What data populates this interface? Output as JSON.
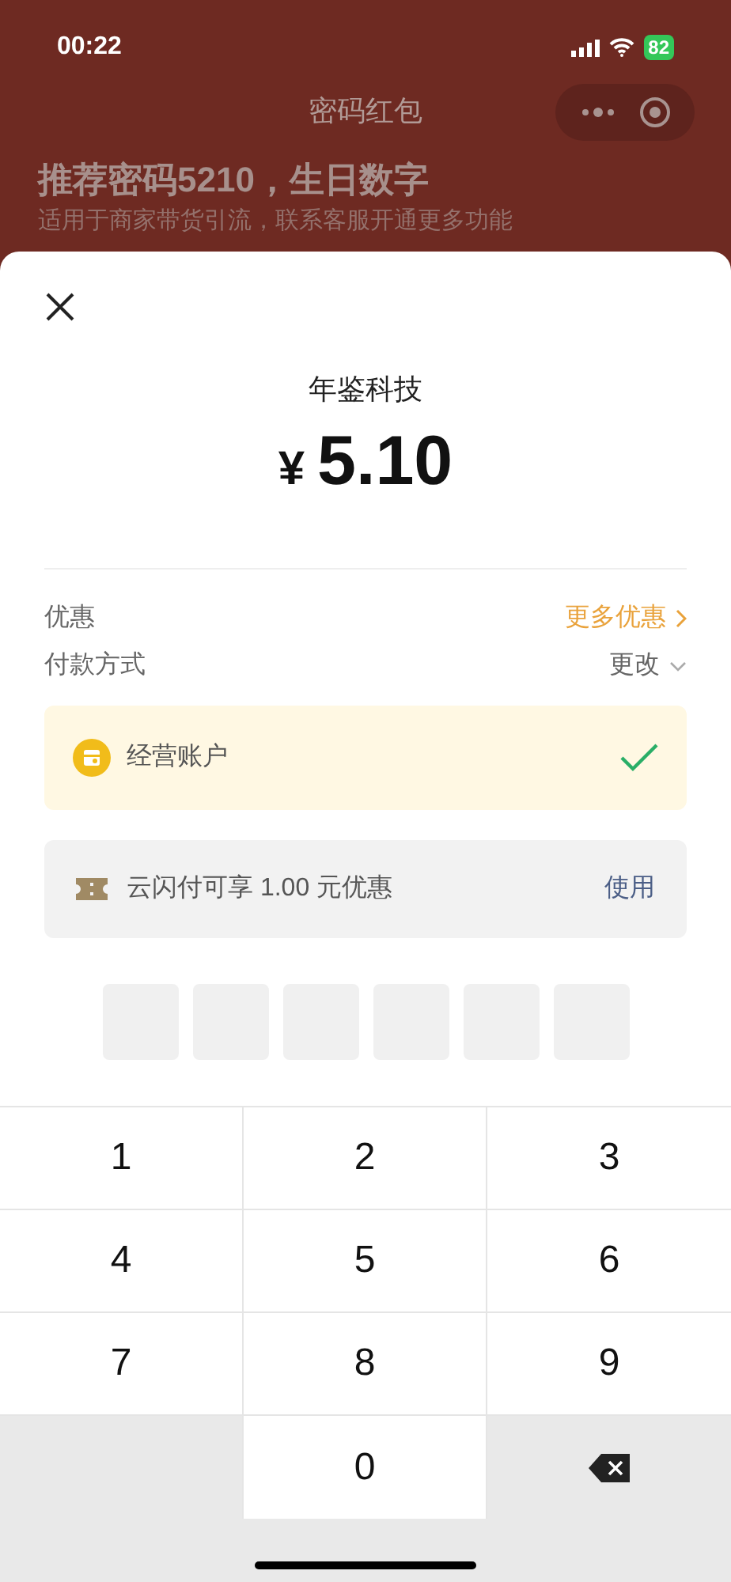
{
  "status_bar": {
    "time": "00:22",
    "battery": "82"
  },
  "header": {
    "title": "密码红包",
    "headline": "推荐密码5210，生日数字",
    "subtitle": "适用于商家带货引流，联系客服开通更多功能"
  },
  "payment": {
    "merchant": "年鉴科技",
    "currency": "¥",
    "amount": "5.10",
    "discount_row": {
      "label": "优惠",
      "action": "更多优惠"
    },
    "method_row": {
      "label": "付款方式",
      "action": "更改"
    },
    "accounts": [
      {
        "name": "经营账户",
        "selected": true
      }
    ],
    "coupon": {
      "text": "云闪付可享 1.00 元优惠",
      "action": "使用"
    },
    "pin": [
      {
        "filled": false
      },
      {
        "filled": false
      },
      {
        "filled": false
      },
      {
        "filled": false
      },
      {
        "filled": false
      },
      {
        "filled": false
      }
    ]
  },
  "keypad": [
    {
      "kind": "digit",
      "label": "1"
    },
    {
      "kind": "digit",
      "label": "2"
    },
    {
      "kind": "digit",
      "label": "3"
    },
    {
      "kind": "digit",
      "label": "4"
    },
    {
      "kind": "digit",
      "label": "5"
    },
    {
      "kind": "digit",
      "label": "6"
    },
    {
      "kind": "digit",
      "label": "7"
    },
    {
      "kind": "digit",
      "label": "8"
    },
    {
      "kind": "digit",
      "label": "9"
    },
    {
      "kind": "blank"
    },
    {
      "kind": "digit",
      "label": "0"
    },
    {
      "kind": "backspace"
    }
  ]
}
